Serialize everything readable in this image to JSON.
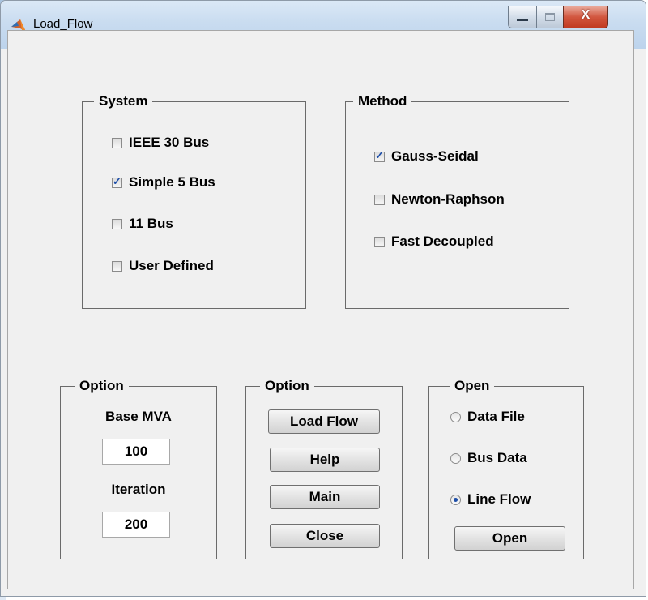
{
  "window": {
    "title": "Load_Flow",
    "app_icon": "matlab-icon",
    "controls": {
      "minimize": "minimize-icon",
      "maximize": "maximize-icon",
      "close": "X"
    }
  },
  "system": {
    "title": "System",
    "options": [
      {
        "label": "IEEE 30 Bus",
        "checked": false
      },
      {
        "label": "Simple 5 Bus",
        "checked": true
      },
      {
        "label": "11 Bus",
        "checked": false
      },
      {
        "label": "User Defined",
        "checked": false
      }
    ]
  },
  "method": {
    "title": "Method",
    "options": [
      {
        "label": "Gauss-Seidal",
        "checked": true
      },
      {
        "label": "Newton-Raphson",
        "checked": false
      },
      {
        "label": "Fast Decoupled",
        "checked": false
      }
    ]
  },
  "option1": {
    "title": "Option",
    "base_mva_label": "Base MVA",
    "base_mva_value": "100",
    "iteration_label": "Iteration",
    "iteration_value": "200"
  },
  "option2": {
    "title": "Option",
    "buttons": [
      "Load Flow",
      "Help",
      "Main",
      "Close"
    ]
  },
  "open": {
    "title": "Open",
    "options": [
      {
        "label": "Data File",
        "selected": false
      },
      {
        "label": "Bus Data",
        "selected": false
      },
      {
        "label": "Line Flow",
        "selected": true
      }
    ],
    "button": "Open"
  },
  "colors": {
    "accent": "#1d4ea8",
    "panel": "#f0f0f0"
  }
}
